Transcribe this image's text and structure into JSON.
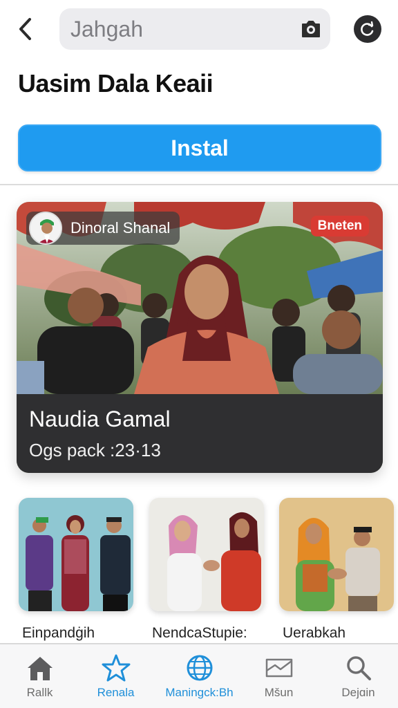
{
  "header": {
    "search_placeholder": "Jahgah",
    "back_icon": "chevron-left-icon",
    "camera_icon": "camera-icon",
    "refresh_icon": "refresh-icon"
  },
  "app": {
    "title": "Uasim Dala Keaii",
    "install_label": "Instal"
  },
  "feature": {
    "creator_name": "Dinoral Shanal",
    "badge": "Bneten",
    "title": "Naudia Gamal",
    "meta": "Ogs pack :23·13"
  },
  "thumbnails": [
    {
      "label": "Einpandġih"
    },
    {
      "label": "NendcaStupie:"
    },
    {
      "label": "Uerabkah"
    }
  ],
  "bottom_nav": [
    {
      "label": "Rallk",
      "icon": "home-icon",
      "active": false
    },
    {
      "label": "Renala",
      "icon": "star-icon",
      "active": true
    },
    {
      "label": "Maningck:Bh",
      "icon": "globe-icon",
      "active": true
    },
    {
      "label": "Mšun",
      "icon": "message-icon",
      "active": false
    },
    {
      "label": "Dejɑin",
      "icon": "search-icon",
      "active": false
    }
  ],
  "colors": {
    "accent": "#1f9bf0",
    "badge": "#d93b33",
    "nav_active": "#1f8fd9"
  }
}
